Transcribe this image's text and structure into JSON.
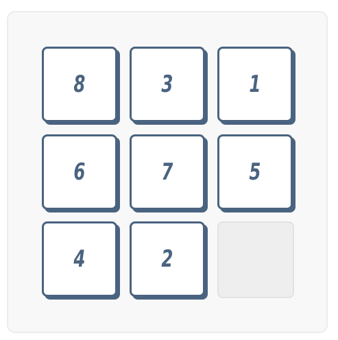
{
  "puzzle": {
    "tiles": [
      {
        "label": "8"
      },
      {
        "label": "3"
      },
      {
        "label": "1"
      },
      {
        "label": "6"
      },
      {
        "label": "7"
      },
      {
        "label": "5"
      },
      {
        "label": "4"
      },
      {
        "label": "2"
      }
    ],
    "empty_cell": {
      "row": 3,
      "col": 3
    },
    "colors": {
      "tile_border": "#4a6380",
      "tile_text": "#4a6380",
      "tile_fill": "#ffffff",
      "empty_fill": "#eeeeee",
      "board_fill": "#f8f8f8"
    }
  }
}
